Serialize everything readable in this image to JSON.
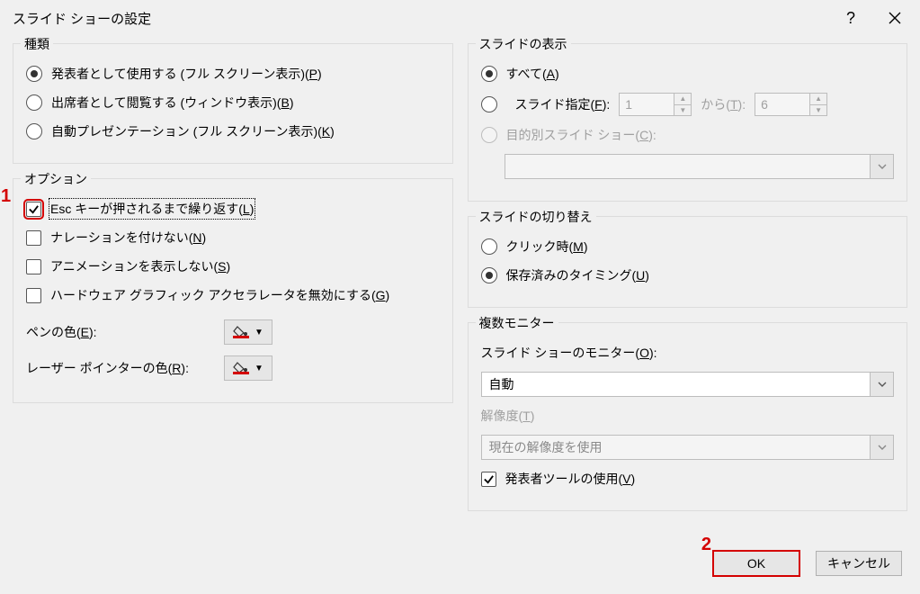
{
  "title": "スライド ショーの設定",
  "annotations": {
    "a1": "1",
    "a2": "2"
  },
  "type_group": {
    "title": "種類",
    "opt1": {
      "pre": "発表者として使用する (フル スクリーン表示)(",
      "key": "P",
      "post": ")"
    },
    "opt2": {
      "pre": "出席者として閲覧する (ウィンドウ表示)(",
      "key": "B",
      "post": ")"
    },
    "opt3": {
      "pre": "自動プレゼンテーション (フル スクリーン表示)(",
      "key": "K",
      "post": ")"
    }
  },
  "options_group": {
    "title": "オプション",
    "loop": {
      "pre": "Esc キーが押されるまで繰り返す(",
      "key": "L",
      "post": ")"
    },
    "narr": {
      "pre": "ナレーションを付けない(",
      "key": "N",
      "post": ")"
    },
    "anim": {
      "pre": "アニメーションを表示しない(",
      "key": "S",
      "post": ")"
    },
    "hw": {
      "pre": "ハードウェア グラフィック アクセラレータを無効にする(",
      "key": "G",
      "post": ")"
    },
    "pen": {
      "pre": "ペンの色(",
      "key": "E",
      "post": "):"
    },
    "laser": {
      "pre": "レーザー ポインターの色(",
      "key": "R",
      "post": "):"
    }
  },
  "show_slides": {
    "title": "スライドの表示",
    "all": {
      "pre": "すべて(",
      "key": "A",
      "post": ")"
    },
    "range": {
      "pre": "スライド指定(",
      "key": "F",
      "post": "):"
    },
    "from_value": "1",
    "to_label": {
      "pre": "から(",
      "key": "T",
      "post": "):"
    },
    "to_value": "6",
    "custom": {
      "pre": "目的別スライド ショー(",
      "key": "C",
      "post": "):"
    },
    "custom_value": ""
  },
  "advance": {
    "title": "スライドの切り替え",
    "manual": {
      "pre": "クリック時(",
      "key": "M",
      "post": ")"
    },
    "timing": {
      "pre": "保存済みのタイミング(",
      "key": "U",
      "post": ")"
    }
  },
  "monitors": {
    "title": "複数モニター",
    "monitor_label": {
      "pre": "スライド ショーのモニター(",
      "key": "O",
      "post": "):"
    },
    "monitor_value": "自動",
    "res_label": {
      "pre": "解像度(",
      "key": "T",
      "post": ")"
    },
    "res_value": "現在の解像度を使用",
    "presenter": {
      "pre": "発表者ツールの使用(",
      "key": "V",
      "post": ")"
    }
  },
  "buttons": {
    "ok": "OK",
    "cancel": "キャンセル"
  }
}
